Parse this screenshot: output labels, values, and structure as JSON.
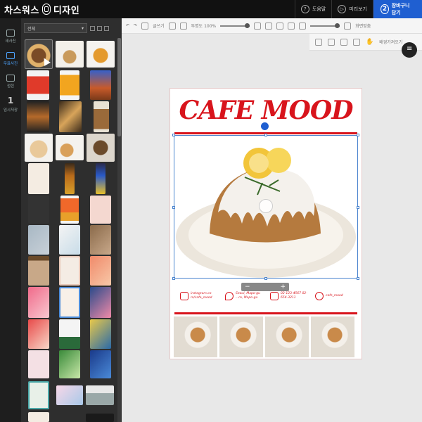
{
  "app": {
    "brand": "차스워스",
    "brand_suffix": "디자인"
  },
  "topbar": {
    "help_label": "도움말",
    "preview_label": "미리보기",
    "cart_label": "장바구니 담기",
    "cart_step": "2",
    "help_icon": "?",
    "preview_icon": "▷"
  },
  "rail": {
    "items": [
      {
        "label": "새사진",
        "icon": "camera-icon"
      },
      {
        "label": "무료사진",
        "icon": "image-icon"
      },
      {
        "label": "접힌",
        "icon": "crop-icon"
      },
      {
        "label": "임시저장",
        "icon": "save-icon",
        "num": "1"
      }
    ]
  },
  "panel": {
    "filter_value": "전체"
  },
  "toolbar": {
    "text_label": "글쓰기",
    "opacity_label": "투명도 100%",
    "fit_label": "화면맞춤",
    "zoom_label": "배경가져오기"
  },
  "poster": {
    "title": "CAFE MOOD",
    "info": [
      {
        "icon": "instagram-icon",
        "text": "instagram.co m/cafe_mood"
      },
      {
        "icon": "location-icon",
        "text": "Seoul, Mapo-gu ...ro, Mapo-gu"
      },
      {
        "icon": "phone-icon",
        "text": "02-123-4567 02-654-3211"
      },
      {
        "icon": "chat-icon",
        "text": "cafe_mood"
      }
    ]
  },
  "zoom": {
    "minus": "−",
    "plus": "+"
  },
  "colors": {
    "accent": "#d8141c",
    "primary": "#1f5fd1",
    "selection": "#4a84ce"
  }
}
